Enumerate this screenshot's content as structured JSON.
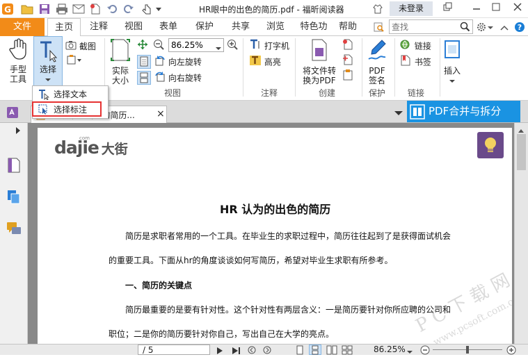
{
  "title_bar": {
    "title": "HR眼中的出色的简历.pdf - 福昕阅读器",
    "login": "未登录",
    "controls": [
      "restore-icon",
      "minimize-icon",
      "maximize-icon",
      "close-icon"
    ]
  },
  "menu": {
    "file": "文件",
    "tabs": [
      "主页",
      "注释",
      "视图",
      "表单",
      "保护",
      "共享",
      "浏览",
      "特色功",
      "帮助"
    ],
    "search_placeholder": "查找"
  },
  "ribbon": {
    "hand_tool": "手型\n工具",
    "select": "选择",
    "screenshot": "截图",
    "actual_size": "实际\n大小",
    "zoom_value": "86.25%",
    "rotate_left": "向左旋转",
    "rotate_right": "向右旋转",
    "view_group": "视图",
    "typewriter": "打字机",
    "highlight": "高亮",
    "annot_group": "注释",
    "to_pdf": "将文件转\n换为PDF",
    "create_group": "创建",
    "pdf_sign": "PDF\n签名",
    "protect_group": "保护",
    "link": "链接",
    "bookmark": "书签",
    "links_group": "链接",
    "insert": "插入"
  },
  "dropdown": {
    "items": [
      "选择文本",
      "选择标注"
    ]
  },
  "doc_tab": {
    "label": "HR眼中的出色的简历...",
    "close": "×"
  },
  "pdf_merge": "PDF合并与拆分",
  "page": {
    "logo_latin": "dajie",
    "logo_cn": "大街",
    "logo_small": "com",
    "heading": "HR 认为的出色的简历",
    "lines": [
      "简历是求职者常用的一个工具。在毕业生的求职过程中，简历往往起到了是获得面试机会",
      "的重要工具。下面从hr的角度谈谈如何写简历，希望对毕业生求职有所参考。",
      "一、简历的关键点",
      "简历最重要的是要有针对性。这个针对性有两层含义：一是简历要针对你所应聘的公司和",
      "职位；二是你的简历要针对你自己，写出自己在大学的亮点。"
    ]
  },
  "watermark": {
    "main": "P C 下 载 网",
    "url": "www.pcsoft.com.cn"
  },
  "statusbar": {
    "page_total": "/ 5",
    "zoom": "86.25%"
  },
  "colors": {
    "accent_orange": "#f28b18",
    "accent_blue": "#1a93e2",
    "highlight_red": "#e63232"
  }
}
